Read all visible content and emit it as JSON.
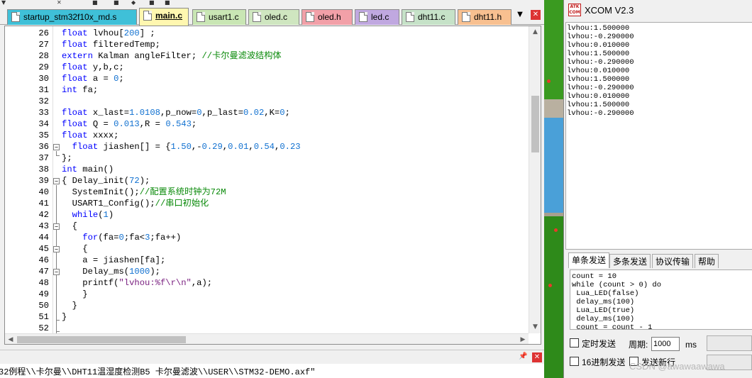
{
  "ide": {
    "tabs": [
      {
        "label": "startup_stm32f10x_md.s",
        "color": "#3fc0d8",
        "active": false
      },
      {
        "label": "main.c",
        "color": "#fff7b0",
        "active": true
      },
      {
        "label": "usart1.c",
        "color": "#c9e6b4",
        "active": false
      },
      {
        "label": "oled.c",
        "color": "#cfe6c0",
        "active": false
      },
      {
        "label": "oled.h",
        "color": "#f2a0a8",
        "active": false
      },
      {
        "label": "led.c",
        "color": "#c0a8e0",
        "active": false
      },
      {
        "label": "dht11.c",
        "color": "#c6e2c8",
        "active": false
      },
      {
        "label": "dht11.h",
        "color": "#f8c090",
        "active": false
      }
    ],
    "tab_menu_icon": "triangle-down-icon",
    "tab_close_icon": "close-icon",
    "line_numbers": [
      "26",
      "27",
      "28",
      "29",
      "30",
      "31",
      "32",
      "33",
      "34",
      "35",
      "36",
      "37",
      "38",
      "39",
      "40",
      "41",
      "42",
      "43",
      "44",
      "45",
      "46",
      "47",
      "48",
      "49",
      "50",
      "51",
      "52"
    ],
    "build_output": "32例程\\\\卡尔曼\\\\DHT11温湿度检测B5 卡尔曼滤波\\\\USER\\\\STM32-DEMO.axf\""
  },
  "xcom": {
    "title": "XCOM V2.3",
    "logo_text": "ATK COM",
    "receive_lines": [
      "lvhou:1.500000",
      "lvhou:-0.290000",
      "lvhou:0.010000",
      "lvhou:1.500000",
      "lvhou:-0.290000",
      "lvhou:0.010000",
      "lvhou:1.500000",
      "lvhou:-0.290000",
      "lvhou:0.010000",
      "lvhou:1.500000",
      "lvhou:-0.290000"
    ],
    "send_tabs": [
      "单条发送",
      "多条发送",
      "协议传输",
      "帮助"
    ],
    "send_lines": [
      "count = 10",
      "while (count > 0) do",
      " Lua_LED(false)",
      " delay_ms(100)",
      " Lua_LED(true)",
      " delay_ms(100)",
      " count = count - 1"
    ],
    "timed_send_label": "定时发送",
    "period_label": "周期:",
    "period_value": "1000",
    "period_unit": "ms",
    "hex_send_label": "16进制发送",
    "newline_label": "发送新行",
    "watermark": "CSDN @awawaawawa"
  },
  "colors": {
    "keyword": "#0000ff",
    "number": "#1070d0",
    "comment": "#0a8a0a",
    "string": "#7a2080"
  }
}
